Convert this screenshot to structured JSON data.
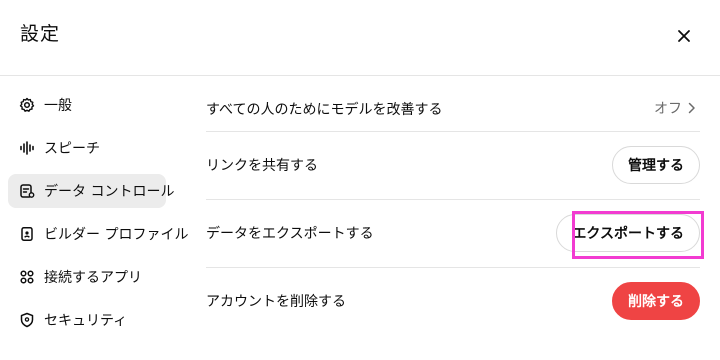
{
  "header": {
    "title": "設定",
    "close_icon": "close-icon"
  },
  "sidebar": {
    "items": [
      {
        "label": "一般",
        "icon": "gear-icon",
        "active": false
      },
      {
        "label": "スピーチ",
        "icon": "audio-wave-icon",
        "active": false
      },
      {
        "label": "データ コントロール",
        "icon": "data-controls-icon",
        "active": true
      },
      {
        "label": "ビルダー プロファイル",
        "icon": "profile-card-icon",
        "active": false
      },
      {
        "label": "接続するアプリ",
        "icon": "apps-grid-icon",
        "active": false
      },
      {
        "label": "セキュリティ",
        "icon": "shield-icon",
        "active": false
      }
    ]
  },
  "settings": {
    "improve_model": {
      "label": "すべての人のためにモデルを改善する",
      "value": "オフ"
    },
    "shared_links": {
      "label": "リンクを共有する",
      "button": "管理する"
    },
    "export_data": {
      "label": "データをエクスポートする",
      "button": "エクスポートする"
    },
    "delete_account": {
      "label": "アカウントを削除する",
      "button": "削除する"
    }
  },
  "colors": {
    "danger": "#ef4444",
    "highlight": "#f23bd1",
    "active_bg": "#ececec"
  }
}
